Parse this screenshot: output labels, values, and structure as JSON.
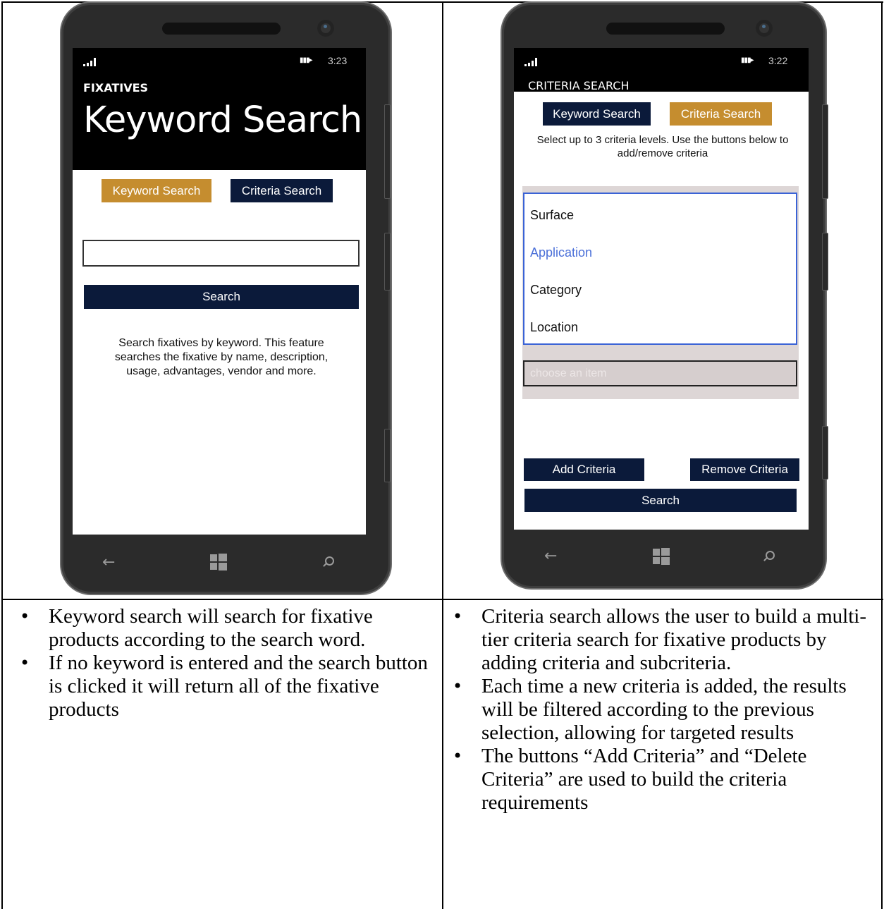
{
  "left_phone": {
    "time": "3:23",
    "app_label": "FIXATIVES",
    "page_title": "Keyword Search",
    "tab_keyword": "Keyword Search",
    "tab_criteria": "Criteria Search",
    "search_input_value": "",
    "search_button": "Search",
    "description": "Search fixatives by keyword. This feature searches the fixative by name, description, usage, advantages, vendor and more."
  },
  "right_phone": {
    "time": "3:22",
    "app_label": "CRITERIA SEARCH",
    "tab_keyword": "Keyword Search",
    "tab_criteria": "Criteria Search",
    "instructions": "Select up to 3 criteria levels. Use the buttons below to add/remove criteria",
    "options": [
      "Surface",
      "Application",
      "Category",
      "Location"
    ],
    "selected_option": "Application",
    "select_placeholder": "choose an item",
    "add_button": "Add Criteria",
    "remove_button": "Remove Criteria",
    "search_button": "Search"
  },
  "captions": {
    "left": [
      "Keyword search will search for fixative products according to the search word.",
      "If no keyword is entered and the search button is clicked it will return all of the fixative products"
    ],
    "right": [
      "Criteria search allows the user to build a multi-tier criteria search for fixative products by adding criteria and subcriteria.",
      "Each time a new criteria is added, the results will be filtered according to the previous selection, allowing for targeted results",
      "The buttons “Add Criteria” and “Delete Criteria” are used to build the criteria requirements"
    ]
  },
  "colors": {
    "navy": "#0b1a3a",
    "gold": "#c58d2f",
    "selected_blue": "#4a6fd8",
    "list_border": "#3b63d6"
  },
  "icons": [
    "signal-icon",
    "battery-icon",
    "back-arrow-icon",
    "windows-start-icon",
    "search-icon"
  ]
}
